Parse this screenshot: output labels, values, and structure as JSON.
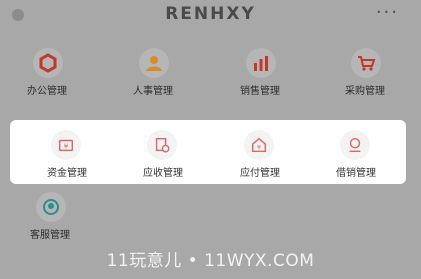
{
  "header": {
    "title": "RENHXY",
    "more_icon": "more-dots-icon",
    "more_glyph": "···"
  },
  "modules": [
    {
      "label": "办公管理",
      "icon": "office-icon",
      "color": "#c0392b"
    },
    {
      "label": "人事管理",
      "icon": "person-icon",
      "color": "#d98a2b"
    },
    {
      "label": "销售管理",
      "icon": "bar-chart-icon",
      "color": "#c0392b"
    },
    {
      "label": "采购管理",
      "icon": "cart-icon",
      "color": "#c0392b"
    }
  ],
  "highlighted_modules": [
    {
      "label": "资金管理",
      "icon": "wallet-icon",
      "color": "#e06666"
    },
    {
      "label": "应收管理",
      "icon": "receivable-icon",
      "color": "#e06666"
    },
    {
      "label": "应付管理",
      "icon": "payable-icon",
      "color": "#e06666"
    },
    {
      "label": "借销管理",
      "icon": "loan-icon",
      "color": "#e06666"
    }
  ],
  "extra_modules": [
    {
      "label": "客服管理",
      "icon": "customer-service-icon",
      "color": "#2a8f8f"
    }
  ],
  "watermark": "11玩意儿 • 11WYX.COM"
}
